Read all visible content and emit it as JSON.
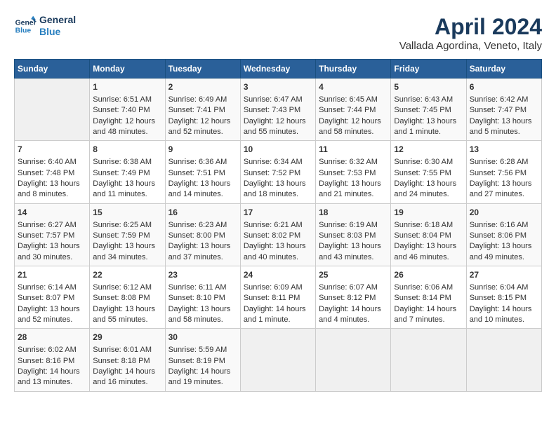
{
  "header": {
    "logo_line1": "General",
    "logo_line2": "Blue",
    "title": "April 2024",
    "subtitle": "Vallada Agordina, Veneto, Italy"
  },
  "days_of_week": [
    "Sunday",
    "Monday",
    "Tuesday",
    "Wednesday",
    "Thursday",
    "Friday",
    "Saturday"
  ],
  "weeks": [
    [
      {
        "day": "",
        "content": ""
      },
      {
        "day": "1",
        "content": "Sunrise: 6:51 AM\nSunset: 7:40 PM\nDaylight: 12 hours\nand 48 minutes."
      },
      {
        "day": "2",
        "content": "Sunrise: 6:49 AM\nSunset: 7:41 PM\nDaylight: 12 hours\nand 52 minutes."
      },
      {
        "day": "3",
        "content": "Sunrise: 6:47 AM\nSunset: 7:43 PM\nDaylight: 12 hours\nand 55 minutes."
      },
      {
        "day": "4",
        "content": "Sunrise: 6:45 AM\nSunset: 7:44 PM\nDaylight: 12 hours\nand 58 minutes."
      },
      {
        "day": "5",
        "content": "Sunrise: 6:43 AM\nSunset: 7:45 PM\nDaylight: 13 hours\nand 1 minute."
      },
      {
        "day": "6",
        "content": "Sunrise: 6:42 AM\nSunset: 7:47 PM\nDaylight: 13 hours\nand 5 minutes."
      }
    ],
    [
      {
        "day": "7",
        "content": "Sunrise: 6:40 AM\nSunset: 7:48 PM\nDaylight: 13 hours\nand 8 minutes."
      },
      {
        "day": "8",
        "content": "Sunrise: 6:38 AM\nSunset: 7:49 PM\nDaylight: 13 hours\nand 11 minutes."
      },
      {
        "day": "9",
        "content": "Sunrise: 6:36 AM\nSunset: 7:51 PM\nDaylight: 13 hours\nand 14 minutes."
      },
      {
        "day": "10",
        "content": "Sunrise: 6:34 AM\nSunset: 7:52 PM\nDaylight: 13 hours\nand 18 minutes."
      },
      {
        "day": "11",
        "content": "Sunrise: 6:32 AM\nSunset: 7:53 PM\nDaylight: 13 hours\nand 21 minutes."
      },
      {
        "day": "12",
        "content": "Sunrise: 6:30 AM\nSunset: 7:55 PM\nDaylight: 13 hours\nand 24 minutes."
      },
      {
        "day": "13",
        "content": "Sunrise: 6:28 AM\nSunset: 7:56 PM\nDaylight: 13 hours\nand 27 minutes."
      }
    ],
    [
      {
        "day": "14",
        "content": "Sunrise: 6:27 AM\nSunset: 7:57 PM\nDaylight: 13 hours\nand 30 minutes."
      },
      {
        "day": "15",
        "content": "Sunrise: 6:25 AM\nSunset: 7:59 PM\nDaylight: 13 hours\nand 34 minutes."
      },
      {
        "day": "16",
        "content": "Sunrise: 6:23 AM\nSunset: 8:00 PM\nDaylight: 13 hours\nand 37 minutes."
      },
      {
        "day": "17",
        "content": "Sunrise: 6:21 AM\nSunset: 8:02 PM\nDaylight: 13 hours\nand 40 minutes."
      },
      {
        "day": "18",
        "content": "Sunrise: 6:19 AM\nSunset: 8:03 PM\nDaylight: 13 hours\nand 43 minutes."
      },
      {
        "day": "19",
        "content": "Sunrise: 6:18 AM\nSunset: 8:04 PM\nDaylight: 13 hours\nand 46 minutes."
      },
      {
        "day": "20",
        "content": "Sunrise: 6:16 AM\nSunset: 8:06 PM\nDaylight: 13 hours\nand 49 minutes."
      }
    ],
    [
      {
        "day": "21",
        "content": "Sunrise: 6:14 AM\nSunset: 8:07 PM\nDaylight: 13 hours\nand 52 minutes."
      },
      {
        "day": "22",
        "content": "Sunrise: 6:12 AM\nSunset: 8:08 PM\nDaylight: 13 hours\nand 55 minutes."
      },
      {
        "day": "23",
        "content": "Sunrise: 6:11 AM\nSunset: 8:10 PM\nDaylight: 13 hours\nand 58 minutes."
      },
      {
        "day": "24",
        "content": "Sunrise: 6:09 AM\nSunset: 8:11 PM\nDaylight: 14 hours\nand 1 minute."
      },
      {
        "day": "25",
        "content": "Sunrise: 6:07 AM\nSunset: 8:12 PM\nDaylight: 14 hours\nand 4 minutes."
      },
      {
        "day": "26",
        "content": "Sunrise: 6:06 AM\nSunset: 8:14 PM\nDaylight: 14 hours\nand 7 minutes."
      },
      {
        "day": "27",
        "content": "Sunrise: 6:04 AM\nSunset: 8:15 PM\nDaylight: 14 hours\nand 10 minutes."
      }
    ],
    [
      {
        "day": "28",
        "content": "Sunrise: 6:02 AM\nSunset: 8:16 PM\nDaylight: 14 hours\nand 13 minutes."
      },
      {
        "day": "29",
        "content": "Sunrise: 6:01 AM\nSunset: 8:18 PM\nDaylight: 14 hours\nand 16 minutes."
      },
      {
        "day": "30",
        "content": "Sunrise: 5:59 AM\nSunset: 8:19 PM\nDaylight: 14 hours\nand 19 minutes."
      },
      {
        "day": "",
        "content": ""
      },
      {
        "day": "",
        "content": ""
      },
      {
        "day": "",
        "content": ""
      },
      {
        "day": "",
        "content": ""
      }
    ]
  ]
}
